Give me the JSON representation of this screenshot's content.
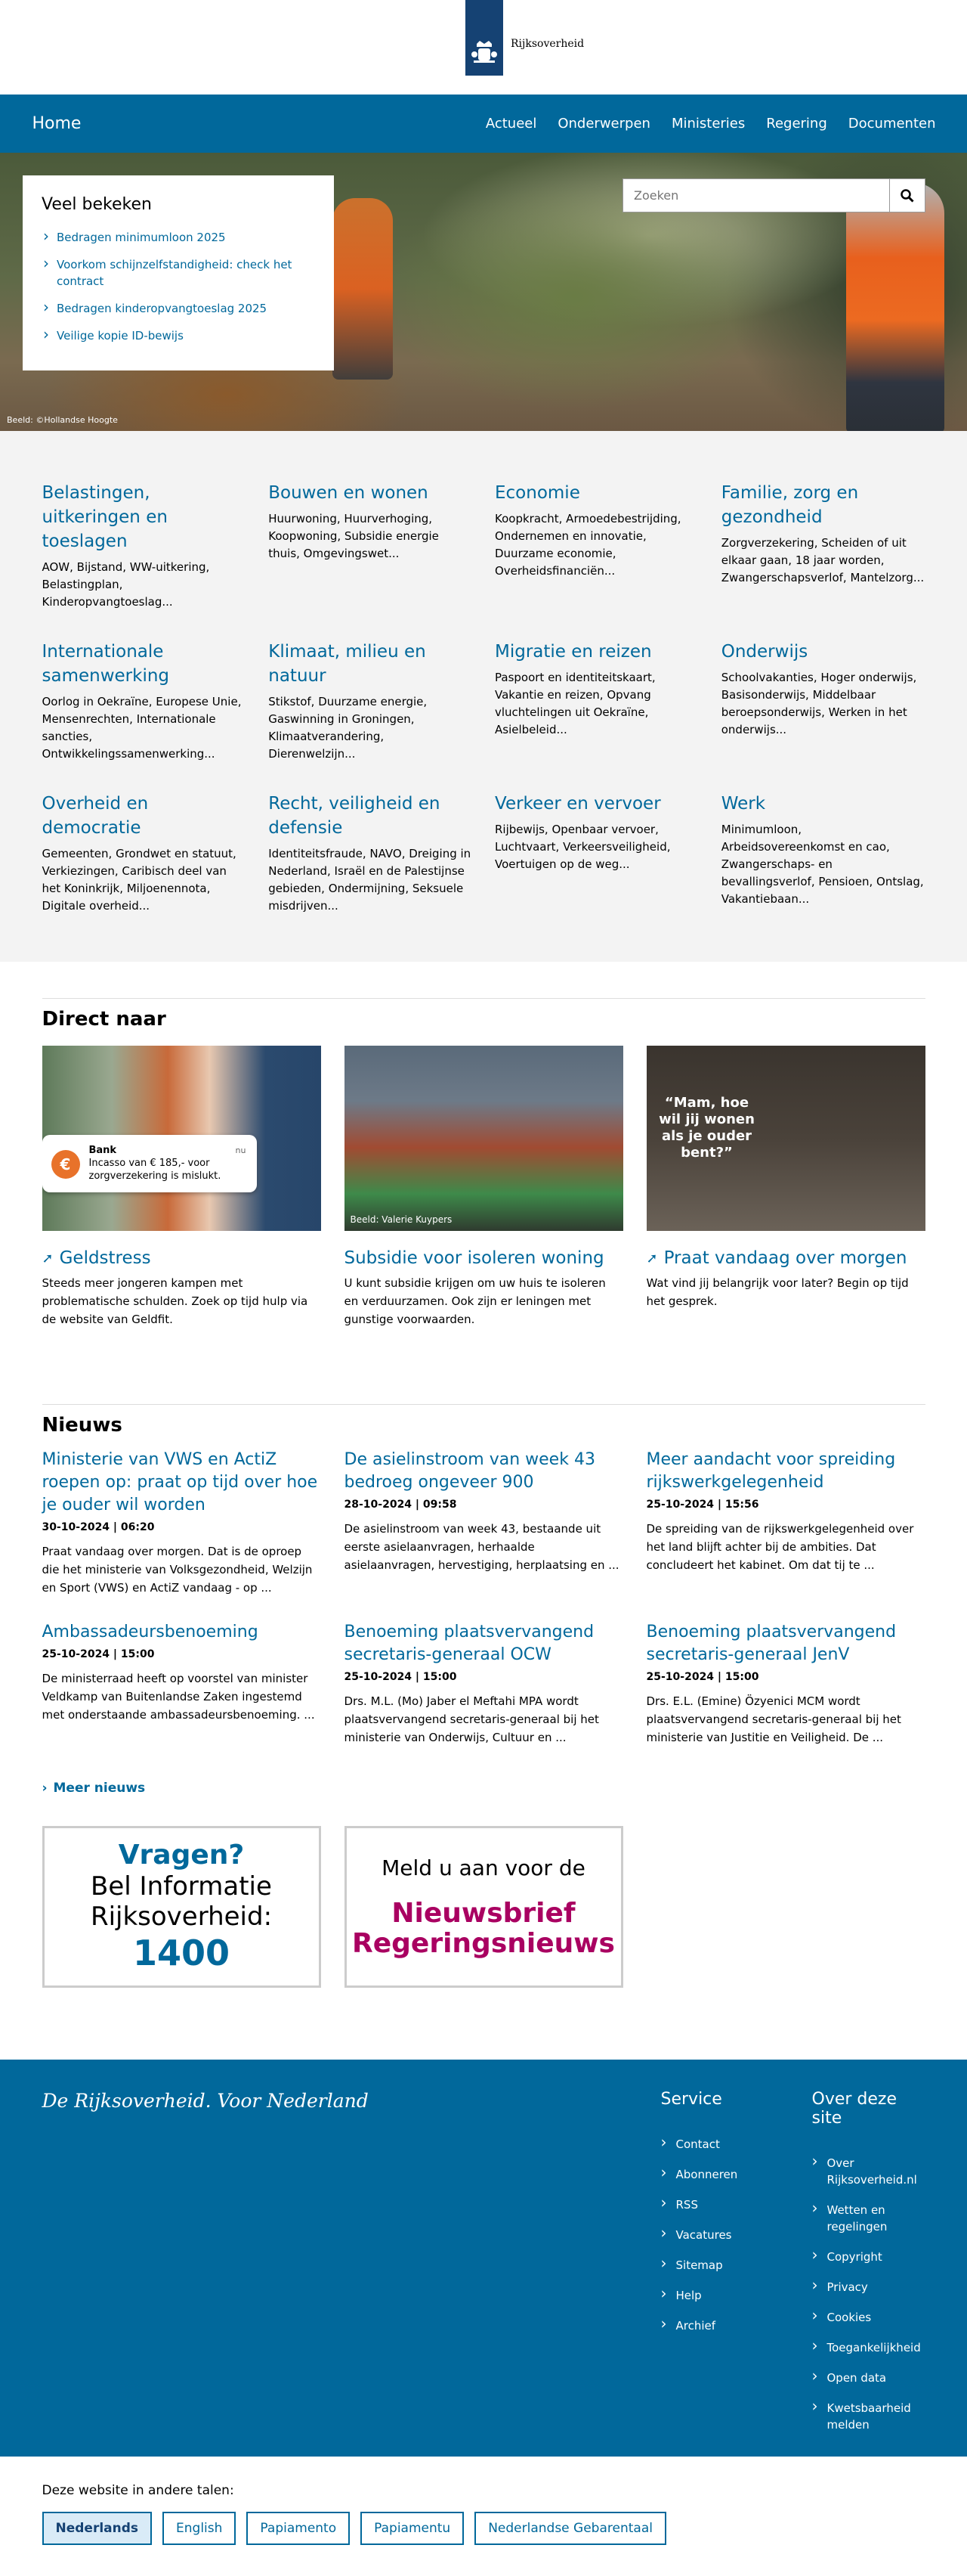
{
  "header": {
    "site_name": "Rijksoverheid"
  },
  "nav": {
    "home": "Home",
    "links": [
      "Actueel",
      "Onderwerpen",
      "Ministeries",
      "Regering",
      "Documenten"
    ]
  },
  "hero": {
    "credit": "Beeld: ©Hollandse Hoogte",
    "popular_title": "Veel bekeken",
    "popular_items": [
      "Bedragen minimumloon 2025",
      "Voorkom schijnzelfstandigheid: check het contract",
      "Bedragen kinderopvangtoeslag 2025",
      "Veilige kopie ID-bewijs"
    ],
    "search_placeholder": "Zoeken"
  },
  "topics": [
    {
      "title": "Belastingen, uitkeringen en toeslagen",
      "desc": "AOW, Bijstand, WW-uitkering, Belastingplan, Kinderopvangtoeslag..."
    },
    {
      "title": "Bouwen en wonen",
      "desc": "Huurwoning, Huurverhoging, Koopwoning, Subsidie energie thuis, Omgevingswet..."
    },
    {
      "title": "Economie",
      "desc": "Koopkracht, Armoedebestrijding, Ondernemen en innovatie, Duurzame economie, Overheidsfinanciën..."
    },
    {
      "title": "Familie, zorg en gezondheid",
      "desc": "Zorgverzekering, Scheiden of uit elkaar gaan, 18 jaar worden, Zwangerschapsverlof, Mantelzorg..."
    },
    {
      "title": "Internationale samenwerking",
      "desc": "Oorlog in Oekraïne, Europese Unie, Mensenrechten, Internationale sancties, Ontwikkelingssamenwerking..."
    },
    {
      "title": "Klimaat, milieu en natuur",
      "desc": "Stikstof, Duurzame energie, Gaswinning in Groningen, Klimaatverandering, Dierenwelzijn..."
    },
    {
      "title": "Migratie en reizen",
      "desc": "Paspoort en identiteitskaart, Vakantie en reizen, Opvang vluchtelingen uit Oekraïne, Asielbeleid..."
    },
    {
      "title": "Onderwijs",
      "desc": "Schoolvakanties, Hoger onderwijs, Basisonderwijs, Middelbaar beroepsonderwijs, Werken in het onderwijs..."
    },
    {
      "title": "Overheid en democratie",
      "desc": "Gemeenten, Grondwet en statuut, Verkiezingen, Caribisch deel van het Koninkrijk, Miljoenennota, Digitale overheid..."
    },
    {
      "title": "Recht, veiligheid en defensie",
      "desc": "Identiteitsfraude, NAVO, Dreiging in Nederland, Israël en de Palestijnse gebieden, Ondermijning, Seksuele misdrijven..."
    },
    {
      "title": "Verkeer en vervoer",
      "desc": "Rijbewijs, Openbaar vervoer, Luchtvaart, Verkeersveiligheid, Voertuigen op de weg..."
    },
    {
      "title": "Werk",
      "desc": "Minimumloon, Arbeidsovereenkomst en cao, Zwangerschaps- en bevallingsverlof, Pensioen, Ontslag, Vakantiebaan..."
    }
  ],
  "direct": {
    "title": "Direct naar",
    "cards": [
      {
        "title": "Geldstress",
        "desc": "Steeds meer jongeren kampen met problematische schulden. Zoek op tijd hulp via de website van Geldfit.",
        "bank_title": "Bank",
        "bank_text": "Incasso van € 185,- voor zorgverzekering is mislukt.",
        "bank_time": "nu"
      },
      {
        "title": "Subsidie voor isoleren woning",
        "desc": "U kunt subsidie krijgen om uw huis te isoleren en verduurzamen. Ook zijn er leningen met gunstige voorwaarden.",
        "credit": "Beeld: Valerie Kuypers"
      },
      {
        "title": "Praat vandaag over morgen",
        "desc": "Wat vind jij belangrijk voor later? Begin op tijd het gesprek.",
        "quote": "“Mam, hoe wil jij wonen als je ouder bent?”"
      }
    ]
  },
  "news": {
    "title": "Nieuws",
    "items": [
      {
        "title": "Ministerie van VWS en ActiZ roepen op: praat op tijd over hoe je ouder wil worden",
        "date": "30-10-2024 | 06:20",
        "desc": "Praat vandaag over morgen. Dat is de oproep die het ministerie van Volksgezondheid, Welzijn en Sport (VWS) en ActiZ vandaag - op ..."
      },
      {
        "title": "De asielinstroom van week 43 bedroeg ongeveer 900",
        "date": "28-10-2024 | 09:58",
        "desc": "De asielinstroom van week 43, bestaande uit eerste asielaanvragen, herhaalde asielaanvragen, hervestiging, herplaatsing en ..."
      },
      {
        "title": "Meer aandacht voor spreiding rijkswerkgelegenheid",
        "date": "25-10-2024 | 15:56",
        "desc": "De spreiding van de rijkswerkgelegenheid over het land blijft achter bij de ambities. Dat concludeert het kabinet. Om dat tij te ..."
      },
      {
        "title": "Ambassadeursbenoeming",
        "date": "25-10-2024 | 15:00",
        "desc": "De ministerraad heeft op voorstel van minister Veldkamp van Buitenlandse Zaken ingestemd met onderstaande ambassadeursbenoeming. ..."
      },
      {
        "title": "Benoeming plaatsvervangend secretaris-generaal OCW",
        "date": "25-10-2024 | 15:00",
        "desc": "Drs. M.L. (Mo) Jaber el Meftahi MPA wordt plaatsvervangend secretaris-generaal bij het ministerie van Onderwijs, Cultuur en ..."
      },
      {
        "title": "Benoeming plaatsvervangend secretaris-generaal JenV",
        "date": "25-10-2024 | 15:00",
        "desc": "Drs. E.L. (Emine) Özyenici MCM wordt plaatsvervangend secretaris-generaal bij het ministerie van Justitie en Veiligheid. De ..."
      }
    ],
    "more": "Meer nieuws"
  },
  "promo": {
    "vragen": "Vragen?",
    "bel": "Bel Informatie Rijksoverheid:",
    "number": "1400",
    "meld": "Meld u aan voor de",
    "nieuwsbrief": "Nieuwsbrief Regeringsnieuws"
  },
  "footer": {
    "slogan": "De Rijksoverheid. Voor Nederland",
    "service_title": "Service",
    "service": [
      "Contact",
      "Abonneren",
      "RSS",
      "Vacatures",
      "Sitemap",
      "Help",
      "Archief"
    ],
    "about_title": "Over deze site",
    "about": [
      "Over Rijksoverheid.nl",
      "Wetten en regelingen",
      "Copyright",
      "Privacy",
      "Cookies",
      "Toegankelijkheid",
      "Open data",
      "Kwetsbaarheid melden"
    ]
  },
  "languages": {
    "label": "Deze website in andere talen:",
    "items": [
      "Nederlands",
      "English",
      "Papiamento",
      "Papiamentu",
      "Nederlandse Gebarentaal"
    ]
  },
  "colors": {
    "primary": "#01689b",
    "logo": "#154273",
    "accent": "#a90061"
  }
}
